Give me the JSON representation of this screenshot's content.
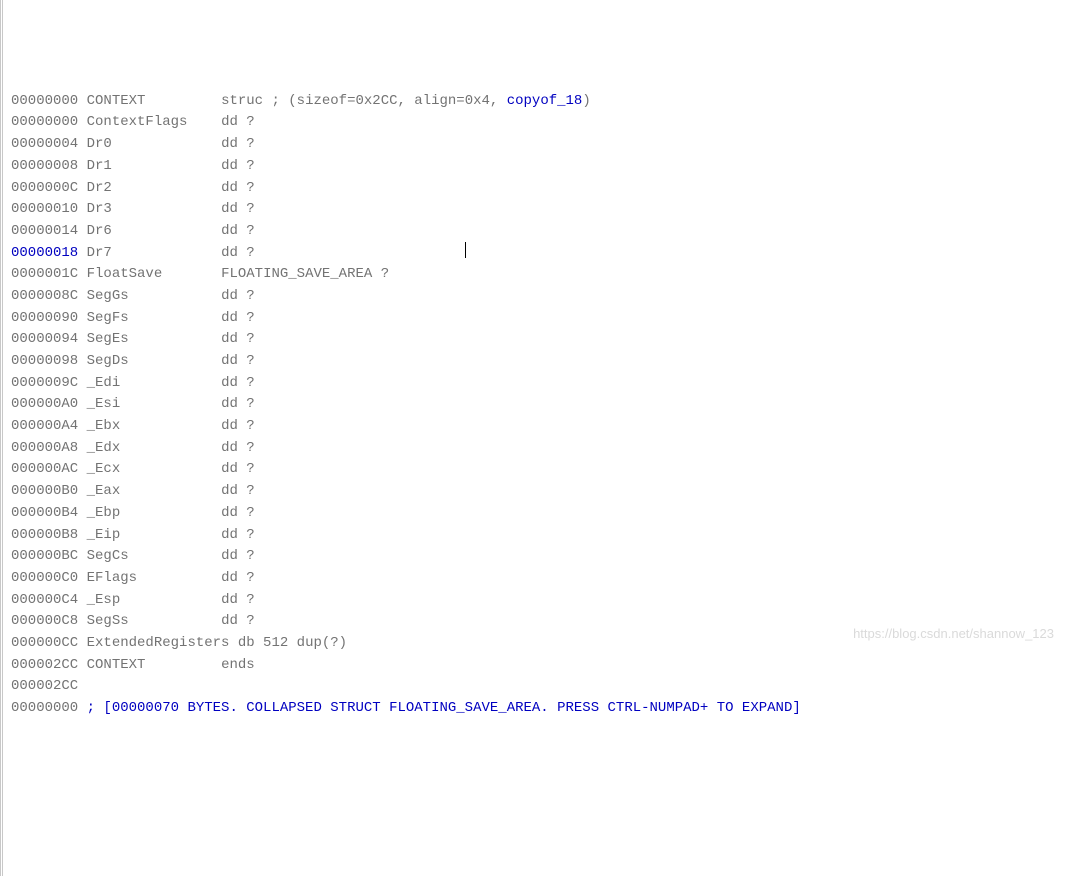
{
  "lines": [
    {
      "offset": "00000000",
      "offsetStyle": "offset",
      "name": "CONTEXT",
      "padName": 15,
      "col3": "struc ; (sizeof=0x2CC, align=0x4, ",
      "link": "copyof_18",
      "tail": ")"
    },
    {
      "offset": "00000000",
      "offsetStyle": "offset",
      "name": "ContextFlags",
      "padName": 15,
      "col3": "dd ?"
    },
    {
      "offset": "00000004",
      "offsetStyle": "offset",
      "name": "Dr0",
      "padName": 15,
      "col3": "dd ?"
    },
    {
      "offset": "00000008",
      "offsetStyle": "offset",
      "name": "Dr1",
      "padName": 15,
      "col3": "dd ?"
    },
    {
      "offset": "0000000C",
      "offsetStyle": "offset",
      "name": "Dr2",
      "padName": 15,
      "col3": "dd ?"
    },
    {
      "offset": "00000010",
      "offsetStyle": "offset",
      "name": "Dr3",
      "padName": 15,
      "col3": "dd ?"
    },
    {
      "offset": "00000014",
      "offsetStyle": "offset",
      "name": "Dr6",
      "padName": 15,
      "col3": "dd ?"
    },
    {
      "offset": "00000018",
      "offsetStyle": "offset-blue",
      "name": "Dr7",
      "padName": 15,
      "col3": "dd ?",
      "hasCursor": true
    },
    {
      "offset": "0000001C",
      "offsetStyle": "offset",
      "name": "FloatSave",
      "padName": 15,
      "col3": "FLOATING_SAVE_AREA ?"
    },
    {
      "offset": "0000008C",
      "offsetStyle": "offset",
      "name": "SegGs",
      "padName": 15,
      "col3": "dd ?"
    },
    {
      "offset": "00000090",
      "offsetStyle": "offset",
      "name": "SegFs",
      "padName": 15,
      "col3": "dd ?"
    },
    {
      "offset": "00000094",
      "offsetStyle": "offset",
      "name": "SegEs",
      "padName": 15,
      "col3": "dd ?"
    },
    {
      "offset": "00000098",
      "offsetStyle": "offset",
      "name": "SegDs",
      "padName": 15,
      "col3": "dd ?"
    },
    {
      "offset": "0000009C",
      "offsetStyle": "offset",
      "name": "_Edi",
      "padName": 15,
      "col3": "dd ?"
    },
    {
      "offset": "000000A0",
      "offsetStyle": "offset",
      "name": "_Esi",
      "padName": 15,
      "col3": "dd ?"
    },
    {
      "offset": "000000A4",
      "offsetStyle": "offset",
      "name": "_Ebx",
      "padName": 15,
      "col3": "dd ?"
    },
    {
      "offset": "000000A8",
      "offsetStyle": "offset",
      "name": "_Edx",
      "padName": 15,
      "col3": "dd ?"
    },
    {
      "offset": "000000AC",
      "offsetStyle": "offset",
      "name": "_Ecx",
      "padName": 15,
      "col3": "dd ?"
    },
    {
      "offset": "000000B0",
      "offsetStyle": "offset",
      "name": "_Eax",
      "padName": 15,
      "col3": "dd ?"
    },
    {
      "offset": "000000B4",
      "offsetStyle": "offset",
      "name": "_Ebp",
      "padName": 15,
      "col3": "dd ?"
    },
    {
      "offset": "000000B8",
      "offsetStyle": "offset",
      "name": "_Eip",
      "padName": 15,
      "col3": "dd ?"
    },
    {
      "offset": "000000BC",
      "offsetStyle": "offset",
      "name": "SegCs",
      "padName": 15,
      "col3": "dd ?"
    },
    {
      "offset": "000000C0",
      "offsetStyle": "offset",
      "name": "EFlags",
      "padName": 15,
      "col3": "dd ?"
    },
    {
      "offset": "000000C4",
      "offsetStyle": "offset",
      "name": "_Esp",
      "padName": 15,
      "col3": "dd ?"
    },
    {
      "offset": "000000C8",
      "offsetStyle": "offset",
      "name": "SegSs",
      "padName": 15,
      "col3": "dd ?"
    },
    {
      "offset": "000000CC",
      "offsetStyle": "offset",
      "name": "ExtendedRegisters",
      "padName": 0,
      "col3": " db 512 dup(?)"
    },
    {
      "offset": "000002CC",
      "offsetStyle": "offset",
      "name": "CONTEXT",
      "padName": 15,
      "col3": "ends"
    },
    {
      "offset": "000002CC",
      "offsetStyle": "offset",
      "name": "",
      "padName": 0,
      "col3": ""
    },
    {
      "offset": "00000000",
      "offsetStyle": "offset",
      "name": "",
      "padName": 0,
      "col3": "",
      "blueComment": "; [00000070 BYTES. COLLAPSED STRUCT FLOATING_SAVE_AREA. PRESS CTRL-NUMPAD+ TO EXPAND]"
    }
  ],
  "watermark": "https://blog.csdn.net/shannow_123"
}
